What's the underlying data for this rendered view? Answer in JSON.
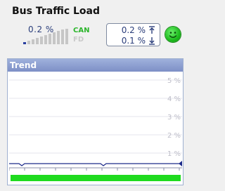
{
  "header": {
    "title": "Bus Traffic Load"
  },
  "load": {
    "current": "0.2 %",
    "level_fraction": 0.002,
    "protocols": [
      "CAN",
      "FD"
    ],
    "active_protocol": "CAN"
  },
  "minmax": {
    "max": "0.2 %",
    "min": "0.1 %"
  },
  "status": {
    "color": "#22c322",
    "icon": "smiley-status-icon"
  },
  "trend": {
    "title": "Trend",
    "y_labels": [
      "5 %",
      "4 %",
      "3 %",
      "2 %",
      "1 %"
    ],
    "colors": {
      "line": "#1c2a8a",
      "fill_bar": "#1fdb1f",
      "grid": "#e6e6ee"
    }
  }
}
